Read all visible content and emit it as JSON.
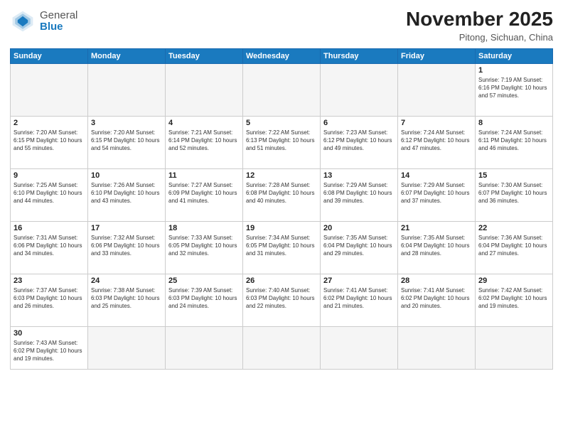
{
  "logo": {
    "general": "General",
    "blue": "Blue"
  },
  "header": {
    "month": "November 2025",
    "location": "Pitong, Sichuan, China"
  },
  "days": [
    "Sunday",
    "Monday",
    "Tuesday",
    "Wednesday",
    "Thursday",
    "Friday",
    "Saturday"
  ],
  "weeks": [
    [
      {
        "day": "",
        "info": ""
      },
      {
        "day": "",
        "info": ""
      },
      {
        "day": "",
        "info": ""
      },
      {
        "day": "",
        "info": ""
      },
      {
        "day": "",
        "info": ""
      },
      {
        "day": "",
        "info": ""
      },
      {
        "day": "1",
        "info": "Sunrise: 7:19 AM\nSunset: 6:16 PM\nDaylight: 10 hours\nand 57 minutes."
      }
    ],
    [
      {
        "day": "2",
        "info": "Sunrise: 7:20 AM\nSunset: 6:15 PM\nDaylight: 10 hours\nand 55 minutes."
      },
      {
        "day": "3",
        "info": "Sunrise: 7:20 AM\nSunset: 6:15 PM\nDaylight: 10 hours\nand 54 minutes."
      },
      {
        "day": "4",
        "info": "Sunrise: 7:21 AM\nSunset: 6:14 PM\nDaylight: 10 hours\nand 52 minutes."
      },
      {
        "day": "5",
        "info": "Sunrise: 7:22 AM\nSunset: 6:13 PM\nDaylight: 10 hours\nand 51 minutes."
      },
      {
        "day": "6",
        "info": "Sunrise: 7:23 AM\nSunset: 6:12 PM\nDaylight: 10 hours\nand 49 minutes."
      },
      {
        "day": "7",
        "info": "Sunrise: 7:24 AM\nSunset: 6:12 PM\nDaylight: 10 hours\nand 47 minutes."
      },
      {
        "day": "8",
        "info": "Sunrise: 7:24 AM\nSunset: 6:11 PM\nDaylight: 10 hours\nand 46 minutes."
      }
    ],
    [
      {
        "day": "9",
        "info": "Sunrise: 7:25 AM\nSunset: 6:10 PM\nDaylight: 10 hours\nand 44 minutes."
      },
      {
        "day": "10",
        "info": "Sunrise: 7:26 AM\nSunset: 6:10 PM\nDaylight: 10 hours\nand 43 minutes."
      },
      {
        "day": "11",
        "info": "Sunrise: 7:27 AM\nSunset: 6:09 PM\nDaylight: 10 hours\nand 41 minutes."
      },
      {
        "day": "12",
        "info": "Sunrise: 7:28 AM\nSunset: 6:08 PM\nDaylight: 10 hours\nand 40 minutes."
      },
      {
        "day": "13",
        "info": "Sunrise: 7:29 AM\nSunset: 6:08 PM\nDaylight: 10 hours\nand 39 minutes."
      },
      {
        "day": "14",
        "info": "Sunrise: 7:29 AM\nSunset: 6:07 PM\nDaylight: 10 hours\nand 37 minutes."
      },
      {
        "day": "15",
        "info": "Sunrise: 7:30 AM\nSunset: 6:07 PM\nDaylight: 10 hours\nand 36 minutes."
      }
    ],
    [
      {
        "day": "16",
        "info": "Sunrise: 7:31 AM\nSunset: 6:06 PM\nDaylight: 10 hours\nand 34 minutes."
      },
      {
        "day": "17",
        "info": "Sunrise: 7:32 AM\nSunset: 6:06 PM\nDaylight: 10 hours\nand 33 minutes."
      },
      {
        "day": "18",
        "info": "Sunrise: 7:33 AM\nSunset: 6:05 PM\nDaylight: 10 hours\nand 32 minutes."
      },
      {
        "day": "19",
        "info": "Sunrise: 7:34 AM\nSunset: 6:05 PM\nDaylight: 10 hours\nand 31 minutes."
      },
      {
        "day": "20",
        "info": "Sunrise: 7:35 AM\nSunset: 6:04 PM\nDaylight: 10 hours\nand 29 minutes."
      },
      {
        "day": "21",
        "info": "Sunrise: 7:35 AM\nSunset: 6:04 PM\nDaylight: 10 hours\nand 28 minutes."
      },
      {
        "day": "22",
        "info": "Sunrise: 7:36 AM\nSunset: 6:04 PM\nDaylight: 10 hours\nand 27 minutes."
      }
    ],
    [
      {
        "day": "23",
        "info": "Sunrise: 7:37 AM\nSunset: 6:03 PM\nDaylight: 10 hours\nand 26 minutes."
      },
      {
        "day": "24",
        "info": "Sunrise: 7:38 AM\nSunset: 6:03 PM\nDaylight: 10 hours\nand 25 minutes."
      },
      {
        "day": "25",
        "info": "Sunrise: 7:39 AM\nSunset: 6:03 PM\nDaylight: 10 hours\nand 24 minutes."
      },
      {
        "day": "26",
        "info": "Sunrise: 7:40 AM\nSunset: 6:03 PM\nDaylight: 10 hours\nand 22 minutes."
      },
      {
        "day": "27",
        "info": "Sunrise: 7:41 AM\nSunset: 6:02 PM\nDaylight: 10 hours\nand 21 minutes."
      },
      {
        "day": "28",
        "info": "Sunrise: 7:41 AM\nSunset: 6:02 PM\nDaylight: 10 hours\nand 20 minutes."
      },
      {
        "day": "29",
        "info": "Sunrise: 7:42 AM\nSunset: 6:02 PM\nDaylight: 10 hours\nand 19 minutes."
      }
    ],
    [
      {
        "day": "30",
        "info": "Sunrise: 7:43 AM\nSunset: 6:02 PM\nDaylight: 10 hours\nand 19 minutes."
      },
      {
        "day": "",
        "info": ""
      },
      {
        "day": "",
        "info": ""
      },
      {
        "day": "",
        "info": ""
      },
      {
        "day": "",
        "info": ""
      },
      {
        "day": "",
        "info": ""
      },
      {
        "day": "",
        "info": ""
      }
    ]
  ]
}
